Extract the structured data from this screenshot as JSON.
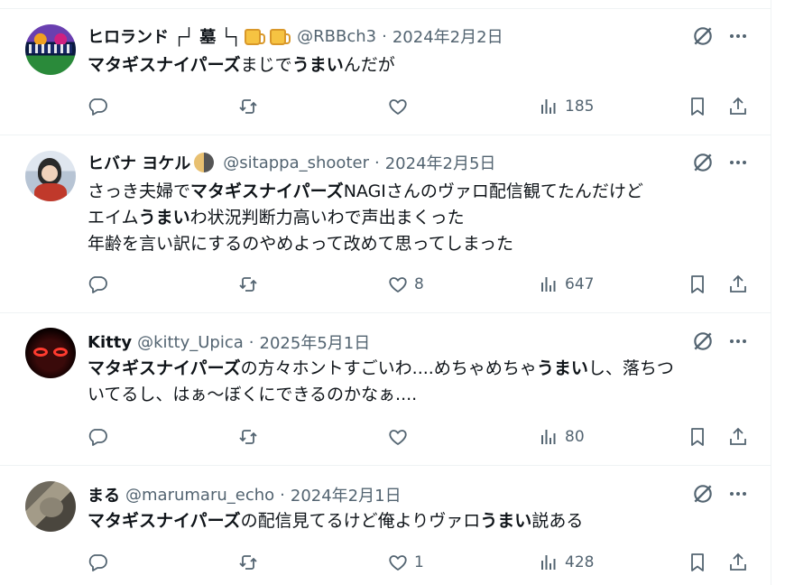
{
  "tweets": [
    {
      "name": "ヒロランド ┌┘ 墓 └┐",
      "handle": "@RBBch3",
      "date": "2024年2月2日",
      "body": [
        [
          {
            "t": "マタギスナイパーズ",
            "b": true
          },
          {
            "t": "まじで",
            "b": false
          },
          {
            "t": "うまい",
            "b": true
          },
          {
            "t": "んだが",
            "b": false
          }
        ]
      ],
      "replies": "",
      "retweets": "",
      "likes": "",
      "views": "185"
    },
    {
      "name": "ヒバナ ヨケル",
      "handle": "@sitappa_shooter",
      "date": "2024年2月5日",
      "body": [
        [
          {
            "t": "さっき夫婦で",
            "b": false
          },
          {
            "t": "マタギスナイパーズ",
            "b": true
          },
          {
            "t": "NAGIさんのヴァロ配信観てたんだけど",
            "b": false
          }
        ],
        [
          {
            "t": "エイム",
            "b": false
          },
          {
            "t": "うまい",
            "b": true
          },
          {
            "t": "わ状況判断力高いわで声出まくった",
            "b": false
          }
        ],
        [
          {
            "t": "年齢を言い訳にするのやめよって改めて思ってしまった",
            "b": false
          }
        ]
      ],
      "replies": "",
      "retweets": "",
      "likes": "8",
      "views": "647"
    },
    {
      "name": "Kitty",
      "handle": "@kitty_Upica",
      "date": "2025年5月1日",
      "body": [
        [
          {
            "t": "マタギスナイパーズ",
            "b": true
          },
          {
            "t": "の方々ホントすごいわ....めちゃめちゃ",
            "b": false
          },
          {
            "t": "うまい",
            "b": true
          },
          {
            "t": "し、落ちつ",
            "b": false
          }
        ],
        [
          {
            "t": "いてるし、はぁ〜ぼくにできるのかなぁ....",
            "b": false
          }
        ]
      ],
      "replies": "",
      "retweets": "",
      "likes": "",
      "views": "80"
    },
    {
      "name": "まる",
      "handle": "@marumaru_echo",
      "date": "2024年2月1日",
      "body": [
        [
          {
            "t": "マタギスナイパーズ",
            "b": true
          },
          {
            "t": "の配信見てるけど俺よりヴァロ",
            "b": false
          },
          {
            "t": "うまい",
            "b": true
          },
          {
            "t": "説ある",
            "b": false
          }
        ]
      ],
      "replies": "",
      "retweets": "",
      "likes": "1",
      "views": "428"
    }
  ],
  "icons": {
    "reply": "reply-icon",
    "retweet": "retweet-icon",
    "like": "heart-icon",
    "views": "analytics-icon",
    "bookmark": "bookmark-icon",
    "share": "share-icon",
    "grok": "grok-icon",
    "more": "more-icon"
  },
  "colors": {
    "text": "#0f1419",
    "secondary": "#536471",
    "divider": "#eff3f4"
  }
}
